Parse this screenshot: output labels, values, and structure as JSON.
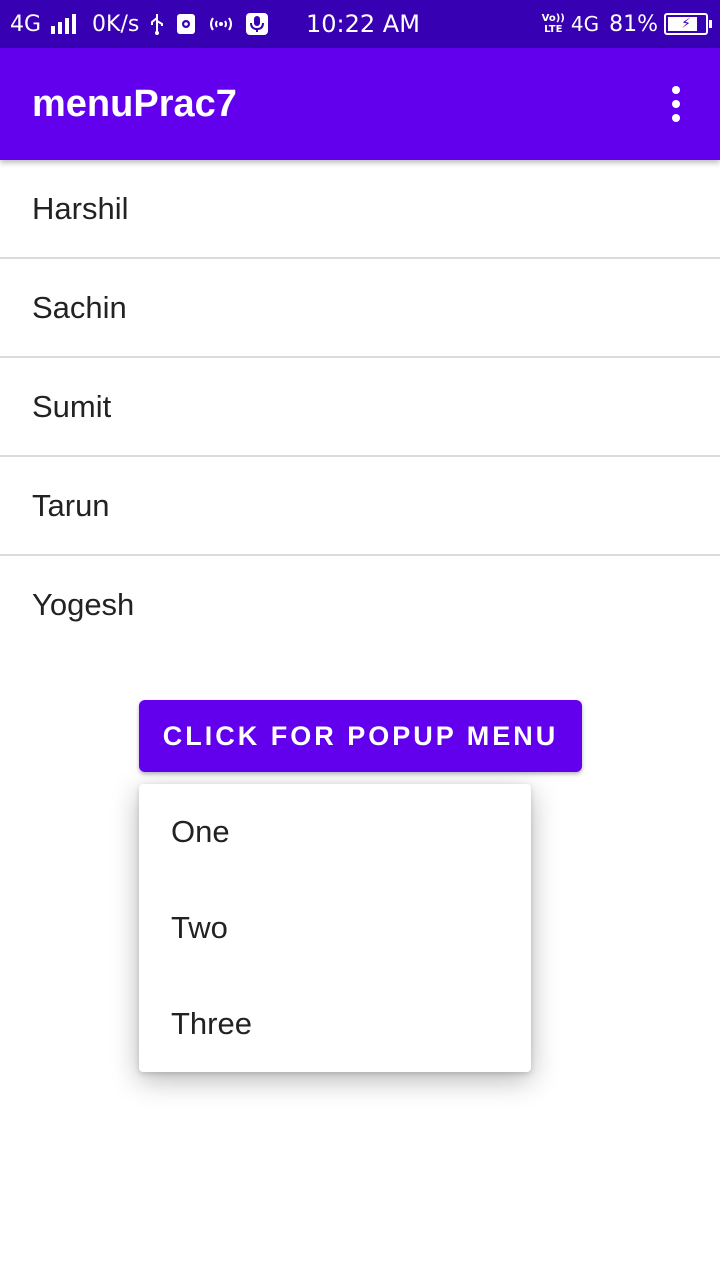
{
  "status_bar": {
    "network_type": "4G",
    "data_speed": "0K/s",
    "time": "10:22 AM",
    "volte_top": "Vo))",
    "volte_bottom": "LTE",
    "network_type_right": "4G",
    "battery_percent": "81%",
    "battery_level": 0.81,
    "icons": [
      "signal-icon",
      "usb-icon",
      "settings-notification-icon",
      "hotspot-icon",
      "microphone-icon",
      "battery-charging-icon"
    ]
  },
  "app_bar": {
    "title": "menuPrac7",
    "overflow_icon": "more-vert-icon"
  },
  "list": {
    "items": [
      "Harshil",
      "Sachin",
      "Sumit",
      "Tarun",
      "Yogesh"
    ]
  },
  "popup_button": {
    "label": "CLICK FOR POPUP MENU"
  },
  "popup_menu": {
    "items": [
      "One",
      "Two",
      "Three"
    ]
  },
  "colors": {
    "status_bar": "#3700b3",
    "app_bar": "#6200ee",
    "text": "#222222",
    "divider": "#dcdcdc"
  }
}
